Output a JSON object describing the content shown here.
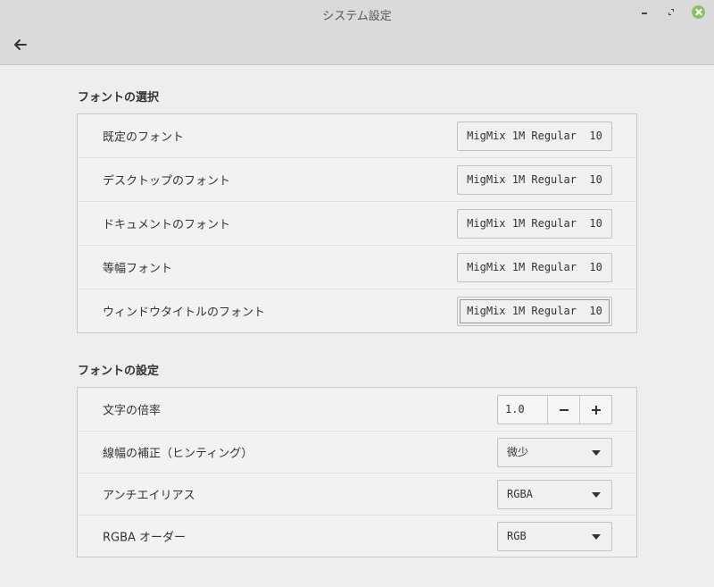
{
  "window": {
    "title": "システム設定"
  },
  "font_selection": {
    "title": "フォントの選択",
    "rows": [
      {
        "label": "既定のフォント",
        "font": "MigMix 1M Regular  10"
      },
      {
        "label": "デスクトップのフォント",
        "font": "MigMix 1M Regular  10"
      },
      {
        "label": "ドキュメントのフォント",
        "font": "MigMix 1M Regular  10"
      },
      {
        "label": "等幅フォント",
        "font": "MigMix 1M Regular  10"
      },
      {
        "label": "ウィンドウタイトルのフォント",
        "font": "MigMix 1M Regular  10"
      }
    ]
  },
  "font_settings": {
    "title": "フォントの設定",
    "text_scale": {
      "label": "文字の倍率",
      "value": "1.0"
    },
    "hinting": {
      "label": "線幅の補正（ヒンティング）",
      "value": "微少"
    },
    "antialiasing": {
      "label": "アンチエイリアス",
      "value": "RGBA"
    },
    "rgba_order": {
      "label": "RGBA オーダー",
      "value": "RGB"
    }
  },
  "icons": {
    "back": "arrow-left-icon",
    "close": "close-icon",
    "minimize": "minimize-icon",
    "maximize": "maximize-icon"
  },
  "colors": {
    "close_button": "#8cc263",
    "header": "#dadada",
    "background": "#eeeeee"
  }
}
